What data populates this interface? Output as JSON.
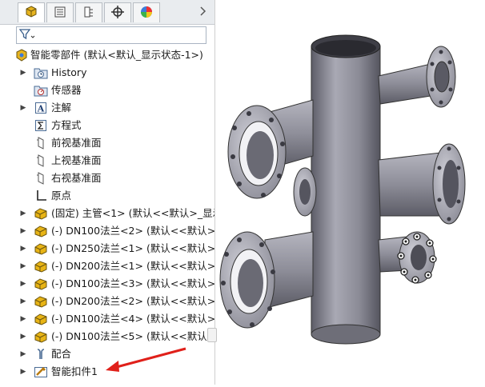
{
  "panel": {
    "tabs": [
      {
        "icon": "feature-manager-icon",
        "active": true
      },
      {
        "icon": "property-manager-icon",
        "active": false
      },
      {
        "icon": "configuration-manager-icon",
        "active": false
      },
      {
        "icon": "dimxpert-icon",
        "active": false
      },
      {
        "icon": "display-manager-icon",
        "active": false
      }
    ],
    "tab_more_icon": "chevron-right-icon",
    "filter_icon": "filter-icon",
    "root": {
      "label": "智能零部件  (默认<默认_显示状态-1>)",
      "icon": "part-icon"
    },
    "items": [
      {
        "label": "History",
        "icon": "history-folder-icon",
        "expandable": true
      },
      {
        "label": "传感器",
        "icon": "sensor-icon",
        "expandable": false
      },
      {
        "label": "注解",
        "icon": "annotation-icon",
        "expandable": true
      },
      {
        "label": "方程式",
        "icon": "equation-icon",
        "expandable": false
      },
      {
        "label": "前视基准面",
        "icon": "plane-icon",
        "expandable": false
      },
      {
        "label": "上视基准面",
        "icon": "plane-icon",
        "expandable": false
      },
      {
        "label": "右视基准面",
        "icon": "plane-icon",
        "expandable": false
      },
      {
        "label": "原点",
        "icon": "origin-icon",
        "expandable": false
      },
      {
        "label": "(固定) 主管<1> (默认<<默认>_显示",
        "icon": "component-icon",
        "expandable": true
      },
      {
        "label": "(-) DN100法兰<2> (默认<<默认>_",
        "icon": "component-icon",
        "expandable": true
      },
      {
        "label": "(-) DN250法兰<1> (默认<<默认>_",
        "icon": "component-icon",
        "expandable": true
      },
      {
        "label": "(-) DN200法兰<1> (默认<<默认>_",
        "icon": "component-icon",
        "expandable": true
      },
      {
        "label": "(-) DN100法兰<3> (默认<<默认>_",
        "icon": "component-icon",
        "expandable": true
      },
      {
        "label": "(-) DN200法兰<2> (默认<<默认>_",
        "icon": "component-icon",
        "expandable": true
      },
      {
        "label": "(-) DN100法兰<4> (默认<<默认>_",
        "icon": "component-icon",
        "expandable": true
      },
      {
        "label": "(-) DN100法兰<5> (默认<<默认>_",
        "icon": "component-icon",
        "expandable": true
      },
      {
        "label": "配合",
        "icon": "mates-icon",
        "expandable": true
      },
      {
        "label": "智能扣件1",
        "icon": "smart-fastener-icon",
        "expandable": true
      }
    ]
  },
  "colors": {
    "annotation_arrow": "#e0201a",
    "component_yellow": "#e8b415",
    "pipe_gray": "#8e8e99"
  }
}
